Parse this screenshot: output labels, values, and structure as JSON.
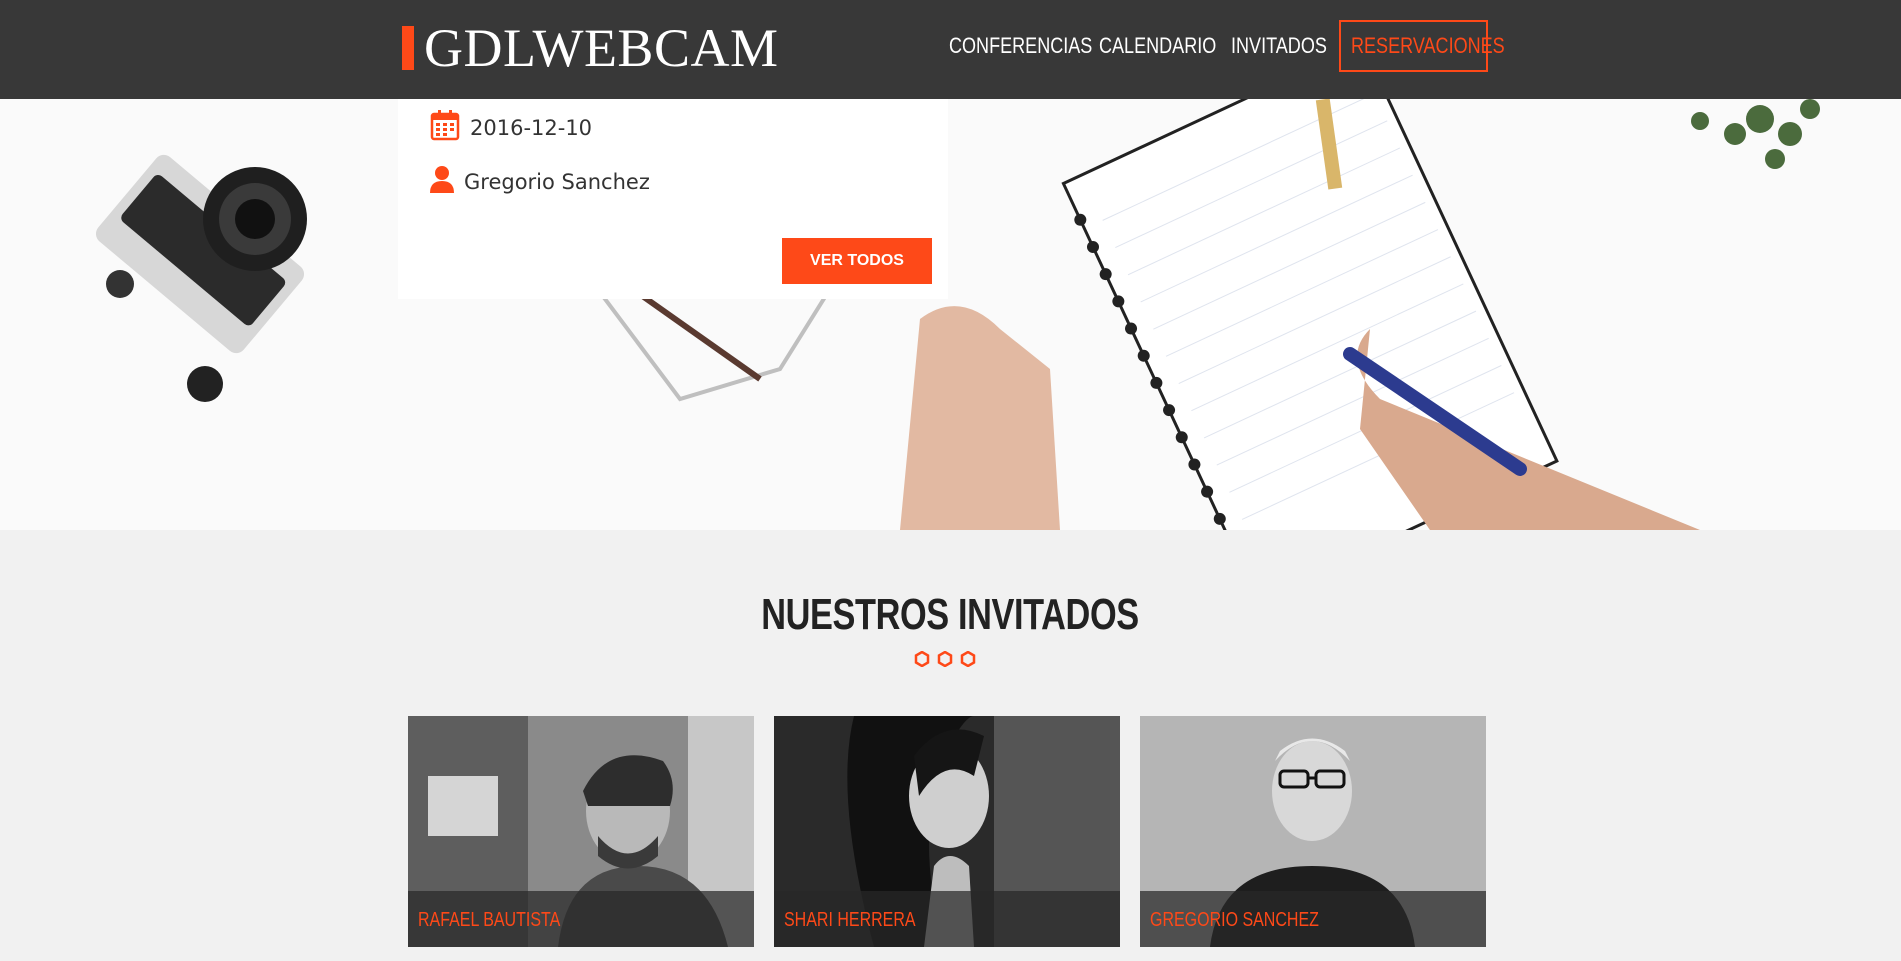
{
  "header": {
    "logo": "GDLWEBCAM",
    "nav": [
      {
        "label": "CONFERENCIAS"
      },
      {
        "label": "CALENDARIO"
      },
      {
        "label": "INVITADOS"
      },
      {
        "label": "RESERVACIONES"
      }
    ]
  },
  "hero": {
    "date": "2016-12-10",
    "author": "Gregorio Sanchez",
    "button": "VER TODOS"
  },
  "section": {
    "title": "NUESTROS INVITADOS"
  },
  "guests": [
    {
      "name": "RAFAEL BAUTISTA"
    },
    {
      "name": "SHARI HERRERA"
    },
    {
      "name": "GREGORIO SANCHEZ"
    }
  ],
  "colors": {
    "accent": "#fe4918",
    "header_bg": "#383838",
    "page_bg": "#f1f1f1"
  },
  "icons": {
    "date": "calendar-icon",
    "author": "user-icon",
    "divider": "hexagon-icon"
  }
}
